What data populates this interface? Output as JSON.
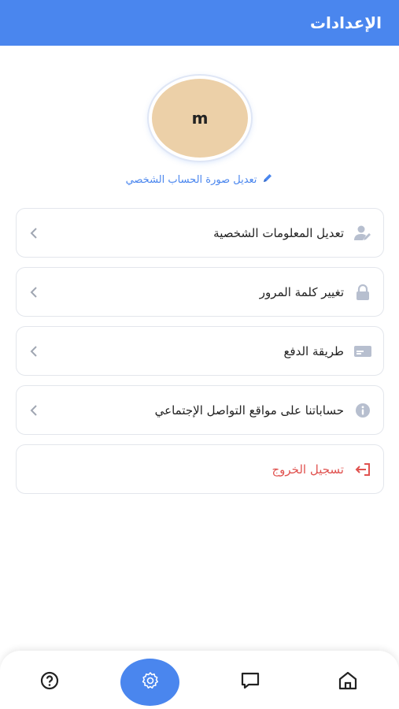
{
  "header": {
    "title": "الإعدادات"
  },
  "profile": {
    "avatar_initial": "m",
    "edit_photo_label": "تعديل صورة الحساب الشخصي"
  },
  "menu": {
    "items": [
      {
        "label": "تعديل المعلومات الشخصية",
        "icon": "user-edit-icon"
      },
      {
        "label": "تغيير كلمة المرور",
        "icon": "lock-icon"
      },
      {
        "label": "طريقة الدفع",
        "icon": "credit-card-icon"
      },
      {
        "label": "حساباتنا على مواقع التواصل الإجتماعي",
        "icon": "info-icon"
      }
    ],
    "logout": {
      "label": "تسجيل الخروج",
      "icon": "logout-icon"
    }
  },
  "bottom_nav": {
    "items": [
      "home-icon",
      "chat-icon",
      "settings-icon",
      "help-icon"
    ],
    "active": "settings-icon"
  },
  "colors": {
    "primary": "#4a86ee",
    "avatar_bg": "#ecd0a8",
    "logout": "#e0524f",
    "icon_gray": "#b7bfcf"
  }
}
